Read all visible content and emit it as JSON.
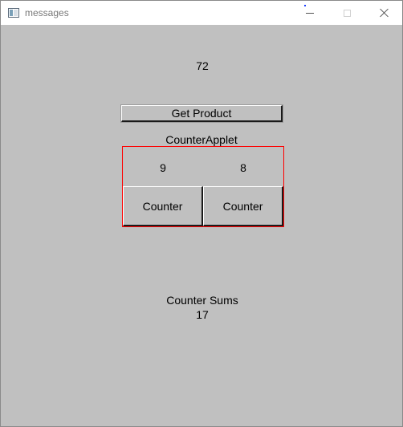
{
  "window": {
    "title": "messages"
  },
  "product": {
    "value": "72",
    "button_label": "Get Product"
  },
  "applet": {
    "title": "CounterApplet",
    "counters": [
      {
        "value": "9",
        "button_label": "Counter"
      },
      {
        "value": "8",
        "button_label": "Counter"
      }
    ],
    "border_color": "#ff0000"
  },
  "sums": {
    "label": "Counter Sums",
    "value": "17"
  },
  "colors": {
    "background": "#c0c0c0",
    "titlebar": "#ffffff"
  },
  "icons": {
    "app": "window-app-icon",
    "minimize": "minimize-icon",
    "maximize": "maximize-icon",
    "close": "close-icon"
  }
}
